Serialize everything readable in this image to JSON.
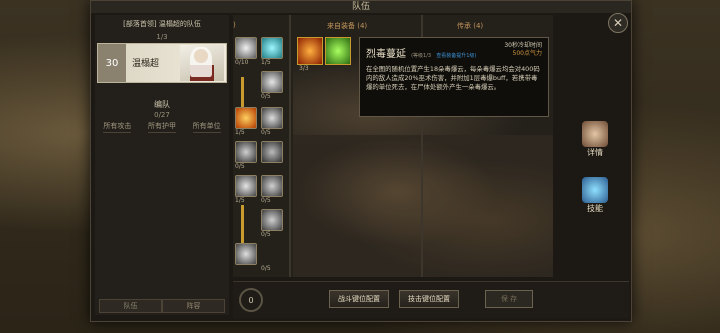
{
  "window": {
    "title": "队伍",
    "close_glyph": "✕"
  },
  "team": {
    "name": "[部落首领] 温榻超的队伍",
    "count": "1/3",
    "hero": {
      "level": "30",
      "name": "温榻超"
    },
    "squad_label": "编队",
    "squad_count": "0/27",
    "filters": [
      "所有攻击",
      "所有护甲",
      "所有单位"
    ],
    "tabs": [
      "队伍",
      "阵容"
    ]
  },
  "columns": {
    "left_partial": ")",
    "equipment": "来自装备 (4)",
    "inherit": "传承 (4)"
  },
  "skill_nums": [
    "0/10",
    "1/5",
    "0/5",
    "1/5",
    "0/5",
    "0/5",
    "1/5",
    "0/5",
    "0/5",
    "0/5"
  ],
  "equip_nums": [
    "3/3"
  ],
  "tooltip": {
    "name": "烈毒蔓延",
    "level": "(等级1/3",
    "upgrade": "查看装备提升1级)",
    "cooldown": "30秒冷却时间",
    "cost": "500点气力",
    "description": "在全图的随机位置产生18朵毒爆云，每朵毒爆云均会对400码内的敌人造成20%巫术伤害，并附加1层毒爆buff，若携带毒爆的单位死去，在尸体处额外产生一朵毒爆云。"
  },
  "side": {
    "details": "详情",
    "skills": "技能"
  },
  "bottom": {
    "gold": "0",
    "battle_keys": "战斗键位配置",
    "skill_keys": "技击键位配置",
    "save": "保 存"
  },
  "colors": {
    "accent": "#c99a2e",
    "tooltip_cost": "#ce9540",
    "tooltip_link": "#3c8fd0"
  }
}
